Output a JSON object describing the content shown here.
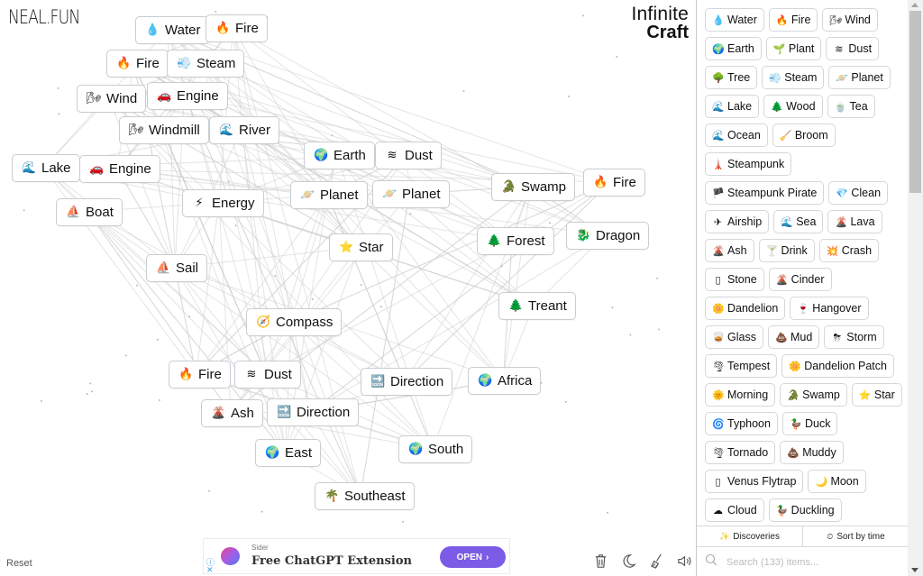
{
  "logo": "NEAL.FUN",
  "brand": {
    "line1": "Infinite",
    "line2": "Craft"
  },
  "canvas_elements": [
    {
      "id": "water-1",
      "icon": "water-drop",
      "glyph": "💧",
      "label": "Water"
    },
    {
      "id": "fire-1",
      "icon": "fire",
      "glyph": "🔥",
      "label": "Fire"
    },
    {
      "id": "fire-2",
      "icon": "fire",
      "glyph": "🔥",
      "label": "Fire"
    },
    {
      "id": "steam-1",
      "icon": "steam",
      "glyph": "💨",
      "label": "Steam"
    },
    {
      "id": "wind-1",
      "icon": "wind",
      "glyph": "🌬",
      "label": "Wind"
    },
    {
      "id": "engine-1",
      "icon": "car",
      "glyph": "🚗",
      "label": "Engine"
    },
    {
      "id": "windmill-1",
      "icon": "wind",
      "glyph": "🌬",
      "label": "Windmill"
    },
    {
      "id": "river-1",
      "icon": "wave",
      "glyph": "🌊",
      "label": "River"
    },
    {
      "id": "lake-1",
      "icon": "wave",
      "glyph": "🌊",
      "label": "Lake"
    },
    {
      "id": "engine-2",
      "icon": "car",
      "glyph": "🚗",
      "label": "Engine"
    },
    {
      "id": "earth-1",
      "icon": "globe",
      "glyph": "🌍",
      "label": "Earth"
    },
    {
      "id": "dust-1",
      "icon": "dust",
      "glyph": "≋",
      "label": "Dust"
    },
    {
      "id": "boat-1",
      "icon": "boat",
      "glyph": "⛵",
      "label": "Boat"
    },
    {
      "id": "energy-1",
      "icon": "lightning",
      "glyph": "⚡",
      "label": "Energy"
    },
    {
      "id": "planet-1",
      "icon": "planet",
      "glyph": "🪐",
      "label": "Planet"
    },
    {
      "id": "planet-2",
      "icon": "planet",
      "glyph": "🪐",
      "label": "Planet"
    },
    {
      "id": "swamp-1",
      "icon": "crocodile",
      "glyph": "🐊",
      "label": "Swamp"
    },
    {
      "id": "fire-3",
      "icon": "fire",
      "glyph": "🔥",
      "label": "Fire"
    },
    {
      "id": "star-1",
      "icon": "star",
      "glyph": "⭐",
      "label": "Star"
    },
    {
      "id": "forest-1",
      "icon": "tree",
      "glyph": "🌲",
      "label": "Forest"
    },
    {
      "id": "dragon-1",
      "icon": "dragon",
      "glyph": "🐉",
      "label": "Dragon"
    },
    {
      "id": "sail-1",
      "icon": "sailboat",
      "glyph": "⛵",
      "label": "Sail"
    },
    {
      "id": "treant-1",
      "icon": "tree",
      "glyph": "🌲",
      "label": "Treant"
    },
    {
      "id": "compass-1",
      "icon": "compass",
      "glyph": "🧭",
      "label": "Compass"
    },
    {
      "id": "fire-4",
      "icon": "fire",
      "glyph": "🔥",
      "label": "Fire"
    },
    {
      "id": "dust-2",
      "icon": "dust",
      "glyph": "≋",
      "label": "Dust"
    },
    {
      "id": "direction-1",
      "icon": "soon-arrow",
      "glyph": "🔜",
      "label": "Direction"
    },
    {
      "id": "africa-1",
      "icon": "globe",
      "glyph": "🌍",
      "label": "Africa"
    },
    {
      "id": "ash-1",
      "icon": "volcano",
      "glyph": "🌋",
      "label": "Ash"
    },
    {
      "id": "direction-2",
      "icon": "soon-arrow",
      "glyph": "🔜",
      "label": "Direction"
    },
    {
      "id": "east-1",
      "icon": "globe",
      "glyph": "🌍",
      "label": "East"
    },
    {
      "id": "south-1",
      "icon": "globe",
      "glyph": "🌍",
      "label": "South"
    },
    {
      "id": "southeast-1",
      "icon": "palm-tree",
      "glyph": "🌴",
      "label": "Southeast"
    }
  ],
  "sidebar": {
    "items": [
      {
        "icon": "water-drop",
        "glyph": "💧",
        "label": "Water"
      },
      {
        "icon": "fire",
        "glyph": "🔥",
        "label": "Fire"
      },
      {
        "icon": "wind",
        "glyph": "🌬",
        "label": "Wind"
      },
      {
        "icon": "globe",
        "glyph": "🌍",
        "label": "Earth"
      },
      {
        "icon": "seedling",
        "glyph": "🌱",
        "label": "Plant"
      },
      {
        "icon": "dust",
        "glyph": "≋",
        "label": "Dust"
      },
      {
        "icon": "tree",
        "glyph": "🌳",
        "label": "Tree"
      },
      {
        "icon": "steam",
        "glyph": "💨",
        "label": "Steam"
      },
      {
        "icon": "planet",
        "glyph": "🪐",
        "label": "Planet"
      },
      {
        "icon": "wave",
        "glyph": "🌊",
        "label": "Lake"
      },
      {
        "icon": "evergreen",
        "glyph": "🌲",
        "label": "Wood"
      },
      {
        "icon": "tea",
        "glyph": "🍵",
        "label": "Tea"
      },
      {
        "icon": "wave",
        "glyph": "🌊",
        "label": "Ocean"
      },
      {
        "icon": "broom",
        "glyph": "🧹",
        "label": "Broom"
      },
      {
        "icon": "lighthouse",
        "glyph": "🗼",
        "label": "Steampunk"
      },
      {
        "icon": "flag",
        "glyph": "🏴",
        "label": "Steampunk Pirate"
      },
      {
        "icon": "gem",
        "glyph": "💎",
        "label": "Clean"
      },
      {
        "icon": "airship",
        "glyph": "✈",
        "label": "Airship"
      },
      {
        "icon": "wave",
        "glyph": "🌊",
        "label": "Sea"
      },
      {
        "icon": "volcano",
        "glyph": "🌋",
        "label": "Lava"
      },
      {
        "icon": "volcano",
        "glyph": "🌋",
        "label": "Ash"
      },
      {
        "icon": "cocktail",
        "glyph": "🍸",
        "label": "Drink"
      },
      {
        "icon": "collision",
        "glyph": "💥",
        "label": "Crash"
      },
      {
        "icon": "rock",
        "glyph": "▯",
        "label": "Stone"
      },
      {
        "icon": "volcano",
        "glyph": "🌋",
        "label": "Cinder"
      },
      {
        "icon": "flower",
        "glyph": "🌼",
        "label": "Dandelion"
      },
      {
        "icon": "wine-glass",
        "glyph": "🍷",
        "label": "Hangover"
      },
      {
        "icon": "glass",
        "glyph": "🥃",
        "label": "Glass"
      },
      {
        "icon": "mud-pile",
        "glyph": "💩",
        "label": "Mud"
      },
      {
        "icon": "storm-cloud",
        "glyph": "⛈",
        "label": "Storm"
      },
      {
        "icon": "tornado",
        "glyph": "🌪",
        "label": "Tempest"
      },
      {
        "icon": "flower",
        "glyph": "🌼",
        "label": "Dandelion Patch"
      },
      {
        "icon": "sun",
        "glyph": "🌞",
        "label": "Morning"
      },
      {
        "icon": "crocodile",
        "glyph": "🐊",
        "label": "Swamp"
      },
      {
        "icon": "star",
        "glyph": "⭐",
        "label": "Star"
      },
      {
        "icon": "cyclone",
        "glyph": "🌀",
        "label": "Typhoon"
      },
      {
        "icon": "duck",
        "glyph": "🦆",
        "label": "Duck"
      },
      {
        "icon": "tornado",
        "glyph": "🌪",
        "label": "Tornado"
      },
      {
        "icon": "mud-pile",
        "glyph": "💩",
        "label": "Muddy"
      },
      {
        "icon": "plant",
        "glyph": "▯",
        "label": "Venus Flytrap"
      },
      {
        "icon": "moon",
        "glyph": "🌙",
        "label": "Moon"
      },
      {
        "icon": "cloud",
        "glyph": "☁",
        "label": "Cloud"
      },
      {
        "icon": "duck",
        "glyph": "🦆",
        "label": "Duckling"
      }
    ],
    "tabs": [
      {
        "icon": "sparkles",
        "glyph": "✨",
        "label": "Discoveries"
      },
      {
        "icon": "clock",
        "glyph": "⏲",
        "label": "Sort by time"
      }
    ],
    "search_placeholder": "Search (133) items..."
  },
  "footer": {
    "reset_label": "Reset",
    "tools": [
      "trash-icon",
      "moon-icon",
      "broom-icon",
      "sound-icon"
    ]
  },
  "ad": {
    "sponsor": "Sider",
    "headline": "Free ChatGPT Extension",
    "cta": "OPEN",
    "info_glyph": "ⓘ",
    "close_glyph": "✕"
  },
  "colors": {
    "ad_button": "#7c5ce6",
    "node_border": "#c8cdd3"
  }
}
